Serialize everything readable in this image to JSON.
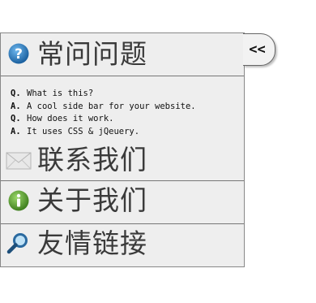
{
  "sections": {
    "faq": {
      "title": "常问问题",
      "icon": "question-circle-icon",
      "color": "#1f6fb0"
    },
    "contact": {
      "title": "联系我们",
      "icon": "envelope-icon"
    },
    "about": {
      "title": "关于我们",
      "icon": "info-circle-icon",
      "color": "#4e9a2a"
    },
    "links": {
      "title": "友情链接",
      "icon": "magnifier-icon"
    }
  },
  "faq_items": [
    {
      "tag": "Q.",
      "text": "What is this?"
    },
    {
      "tag": "A.",
      "text": "A cool side bar for your website."
    },
    {
      "tag": "Q.",
      "text": "How does it work."
    },
    {
      "tag": "A.",
      "text": "It uses CSS & jQeuery."
    }
  ],
  "toggle": {
    "label": "<<"
  }
}
